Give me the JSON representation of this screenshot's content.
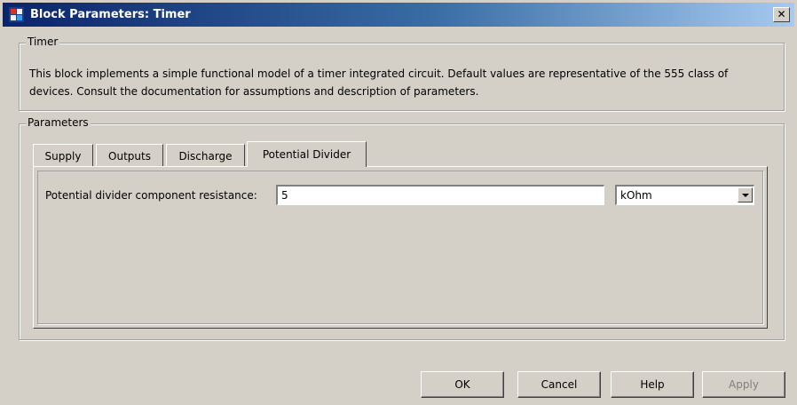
{
  "window": {
    "title": "Block Parameters: Timer"
  },
  "timer_group": {
    "label": "Timer",
    "description": "This block implements a simple functional model of a timer integrated circuit. Default values are representative of the 555 class of devices. Consult the documentation for assumptions and description of parameters."
  },
  "parameters_group": {
    "label": "Parameters",
    "tabs": [
      {
        "label": "Supply"
      },
      {
        "label": "Outputs"
      },
      {
        "label": "Discharge"
      },
      {
        "label": "Potential Divider"
      }
    ],
    "active_tab": "Potential Divider"
  },
  "potential_divider": {
    "resistance_label": "Potential divider component resistance:",
    "resistance_value": "5",
    "resistance_unit": "kOhm"
  },
  "buttons": {
    "ok": "OK",
    "cancel": "Cancel",
    "help": "Help",
    "apply": "Apply"
  },
  "icons": {
    "title_icon": "simulink-block-icon",
    "close_icon": "close-icon",
    "dropdown_icon": "chevron-down-icon"
  }
}
